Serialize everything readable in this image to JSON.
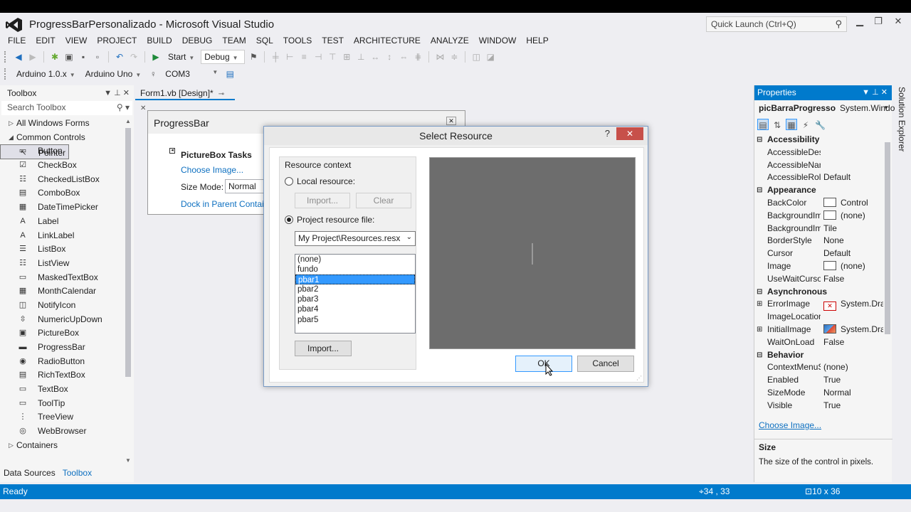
{
  "window": {
    "title": "ProgressBarPersonalizado - Microsoft Visual Studio",
    "quick_launch": "Quick Launch (Ctrl+Q)"
  },
  "menu": [
    "FILE",
    "EDIT",
    "VIEW",
    "PROJECT",
    "BUILD",
    "DEBUG",
    "TEAM",
    "SQL",
    "TOOLS",
    "TEST",
    "ARCHITECTURE",
    "ANALYZE",
    "WINDOW",
    "HELP"
  ],
  "toolbar": {
    "start": "Start",
    "config": "Debug",
    "board_version": "Arduino 1.0.x",
    "board": "Arduino Uno",
    "port": "COM3"
  },
  "toolbox": {
    "title": "Toolbox",
    "search": "Search Toolbox",
    "groups": [
      "All Windows Forms",
      "Common Controls"
    ],
    "items": [
      "Pointer",
      "Button",
      "CheckBox",
      "CheckedListBox",
      "ComboBox",
      "DateTimePicker",
      "Label",
      "LinkLabel",
      "ListBox",
      "ListView",
      "MaskedTextBox",
      "MonthCalendar",
      "NotifyIcon",
      "NumericUpDown",
      "PictureBox",
      "ProgressBar",
      "RadioButton",
      "RichTextBox",
      "TextBox",
      "ToolTip",
      "TreeView",
      "WebBrowser"
    ],
    "footer_group": "Containers",
    "tabs": [
      "Data Sources",
      "Toolbox"
    ]
  },
  "doc": {
    "tab": "Form1.vb [Design]*",
    "form_title": "ProgressBar",
    "tasks": {
      "header": "PictureBox Tasks",
      "choose": "Choose Image...",
      "size_mode_label": "Size Mode:",
      "size_mode": "Normal",
      "dock": "Dock in Parent Contain"
    }
  },
  "dialog": {
    "title": "Select Resource",
    "help": "?",
    "close": "✕",
    "context_label": "Resource context",
    "local": "Local resource:",
    "import_disabled": "Import...",
    "clear": "Clear",
    "project_file": "Project resource file:",
    "resx": "My Project\\Resources.resx",
    "resources": [
      "(none)",
      "fundo",
      "pbar1",
      "pbar2",
      "pbar3",
      "pbar4",
      "pbar5"
    ],
    "selected": "pbar1",
    "import": "Import...",
    "ok": "OK",
    "cancel": "Cancel"
  },
  "properties": {
    "title": "Properties",
    "object": "picBarraProgresso",
    "type": "System.Windo",
    "rows": [
      {
        "cat": "Accessibility"
      },
      {
        "k": "AccessibleDesc",
        "v": ""
      },
      {
        "k": "AccessibleNam",
        "v": ""
      },
      {
        "k": "AccessibleRole",
        "v": "Default"
      },
      {
        "cat": "Appearance"
      },
      {
        "k": "BackColor",
        "v": "Control",
        "sw": "white"
      },
      {
        "k": "BackgroundIm",
        "v": "(none)",
        "sw": "white"
      },
      {
        "k": "BackgroundIm",
        "v": "Tile"
      },
      {
        "k": "BorderStyle",
        "v": "None"
      },
      {
        "k": "Cursor",
        "v": "Default"
      },
      {
        "k": "Image",
        "v": "(none)",
        "sw": "white"
      },
      {
        "k": "UseWaitCursor",
        "v": "False"
      },
      {
        "cat": "Asynchronous"
      },
      {
        "k": "ErrorImage",
        "v": "System.Dra",
        "sw": "err",
        "exp": true
      },
      {
        "k": "ImageLocation",
        "v": ""
      },
      {
        "k": "InitialImage",
        "v": "System.Dra",
        "sw": "img",
        "exp": true
      },
      {
        "k": "WaitOnLoad",
        "v": "False"
      },
      {
        "cat": "Behavior"
      },
      {
        "k": "ContextMenuS",
        "v": "(none)"
      },
      {
        "k": "Enabled",
        "v": "True"
      },
      {
        "k": "SizeMode",
        "v": "Normal"
      },
      {
        "k": "Visible",
        "v": "True"
      }
    ],
    "link": "Choose Image...",
    "desc_name": "Size",
    "desc_text": "The size of the control in pixels."
  },
  "solution_explorer": "Solution Explorer",
  "status": {
    "text": "Ready",
    "position": "34 , 33",
    "size": "10 x 36"
  }
}
